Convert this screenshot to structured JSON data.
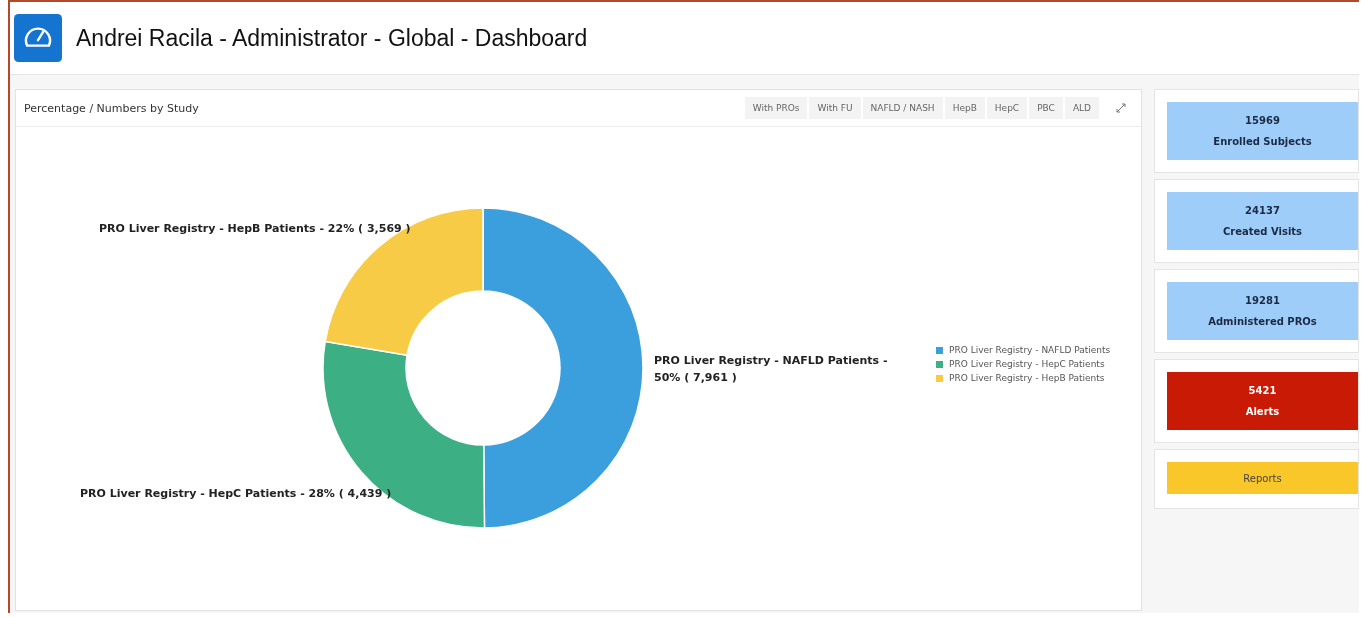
{
  "page": {
    "title": "Andrei Racila - Administrator - Global - Dashboard"
  },
  "chart_panel": {
    "title": "Percentage / Numbers by Study",
    "filters": [
      "With PROs",
      "With FU",
      "NAFLD / NASH",
      "HepB",
      "HepC",
      "PBC",
      "ALD"
    ],
    "chart_data": {
      "type": "donut",
      "categories": [
        "PRO Liver Registry - NAFLD Patients",
        "PRO Liver Registry - HepC Patients",
        "PRO Liver Registry - HepB Patients"
      ],
      "values": [
        7961,
        4439,
        3569
      ],
      "legend": "right",
      "colors": [
        "#3a9fdc",
        "#3caf85",
        "#f8cb47"
      ],
      "value_labels": [
        "PRO Liver Registry - NAFLD Patients - 50% ( 7,961 )",
        "PRO Liver Registry - HepC Patients - 28% ( 4,439 )",
        "PRO Liver Registry - HepB Patients - 22% ( 3,569 )"
      ]
    }
  },
  "stats": [
    {
      "value": "15969",
      "label": "Enrolled Subjects",
      "color": "#9dcdf8"
    },
    {
      "value": "24137",
      "label": "Created Visits",
      "color": "#9dcdf8"
    },
    {
      "value": "19281",
      "label": "Administered PROs",
      "color": "#9dcdf8"
    },
    {
      "value": "5421",
      "label": "Alerts",
      "color": "#c81a05"
    },
    {
      "label": "Reports",
      "color": "#f9c72a"
    }
  ]
}
